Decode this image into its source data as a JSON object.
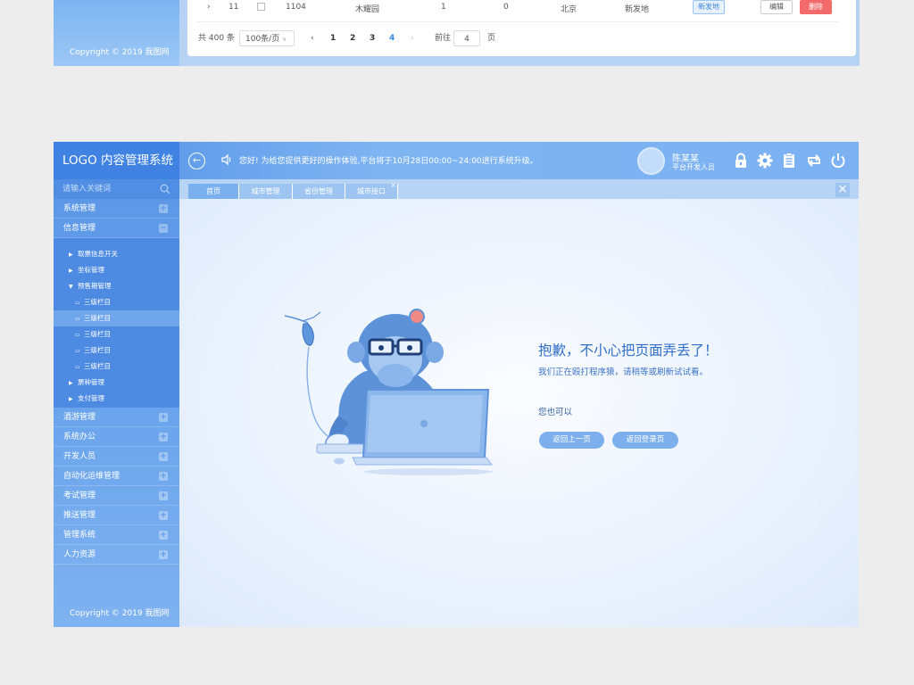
{
  "top_fragment": {
    "row": {
      "id": "11",
      "code": "1104",
      "name": "木耀园",
      "c1": "1",
      "c2": "0",
      "city": "北京",
      "place": "新发地",
      "tag": "新发地",
      "edit": "编辑",
      "delete": "删除"
    },
    "copyright": "Copyright © 2019  我图网",
    "pager": {
      "total": "共 400 条",
      "size": "100条/页",
      "pages": [
        "1",
        "2",
        "3",
        "4"
      ],
      "active_page": "4",
      "goto": "前往",
      "goto_value": "4",
      "page_unit": "页"
    }
  },
  "header": {
    "logo": "LOGO 内容管理系统",
    "notice": "您好! 为给您提供更好的操作体验,平台将于10月28日00:00~24:00进行系统升级。",
    "user_name": "陈某某",
    "user_role": "平台开发人员",
    "icons": [
      "lock-icon",
      "gear-icon",
      "clipboard-icon",
      "swap-icon",
      "power-icon"
    ]
  },
  "sidebar": {
    "search_placeholder": "请输入关键词",
    "top_items": [
      {
        "label": "系统管理",
        "sign": "+"
      },
      {
        "label": "信息管理",
        "sign": "−"
      }
    ],
    "sub_items": [
      {
        "label": "取票信息开关",
        "type": "level2"
      },
      {
        "label": "坐标管理",
        "type": "level2"
      },
      {
        "label": "预售期管理",
        "type": "level2-open"
      },
      {
        "label": "三级栏目",
        "type": "level3"
      },
      {
        "label": "三级栏目",
        "type": "level3"
      },
      {
        "label": "三级栏目",
        "type": "level3"
      },
      {
        "label": "三级栏目",
        "type": "level3"
      },
      {
        "label": "三级栏目",
        "type": "level3"
      },
      {
        "label": "票种管理",
        "type": "level2"
      },
      {
        "label": "支付管理",
        "type": "level2"
      }
    ],
    "bottom_items": [
      {
        "label": "酒游管理",
        "sign": "+"
      },
      {
        "label": "系统办公",
        "sign": "+"
      },
      {
        "label": "开发人员",
        "sign": "+"
      },
      {
        "label": "自动化运维管理",
        "sign": "+"
      },
      {
        "label": "考试管理",
        "sign": "+"
      },
      {
        "label": "推送管理",
        "sign": "+"
      },
      {
        "label": "管理系统",
        "sign": "+"
      },
      {
        "label": "人力资源",
        "sign": "+"
      }
    ],
    "copyright": "Copyright © 2019  我图网"
  },
  "tabs": [
    {
      "label": "首页"
    },
    {
      "label": "城市管理"
    },
    {
      "label": "省份管理"
    },
    {
      "label": "城市接口",
      "closable": true
    }
  ],
  "tab_close_symbol": "×",
  "close_all_symbol": "×",
  "error_page": {
    "title": "抱歉，不小心把页面弄丢了！",
    "description": "我们正在殴打程序猿，请稍等或刷新试试看。",
    "also": "您也可以",
    "btn_back": "返回上一页",
    "btn_login": "返回登录页"
  },
  "colors": {
    "primary": "#4f8fe6",
    "sidebar": "#5b97e6",
    "accent_text": "#2f6fc8",
    "pill": "#7cafec",
    "danger": "#f36a6a"
  }
}
